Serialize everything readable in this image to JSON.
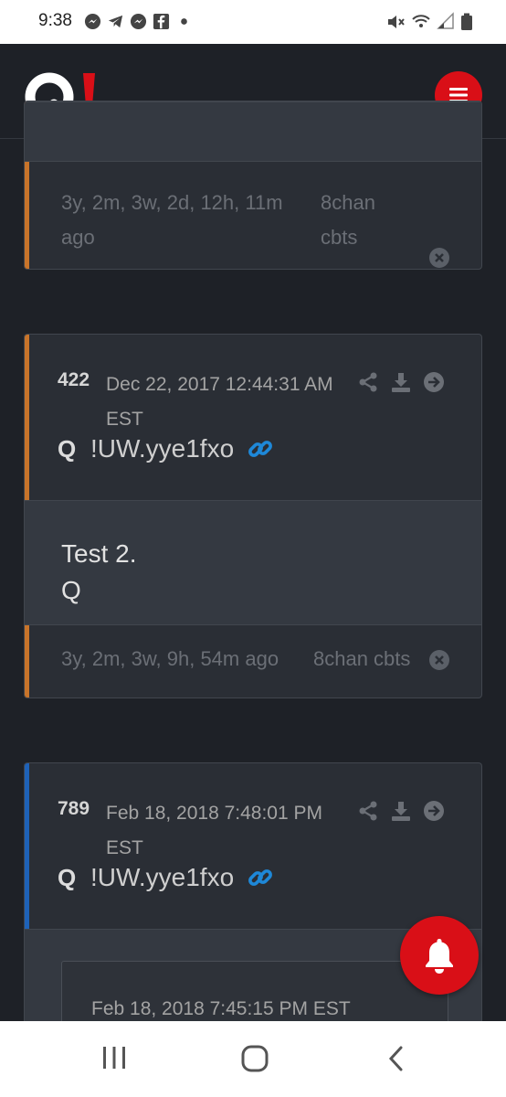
{
  "status_bar": {
    "time": "9:38",
    "notification_icons": [
      "messenger-icon",
      "telegram-icon",
      "messenger-icon",
      "facebook-icon",
      "dot-icon"
    ],
    "system_icons": [
      "mute-icon",
      "wifi-icon",
      "signal-icon",
      "battery-icon"
    ]
  },
  "header": {
    "logo_text": "Q!",
    "logo_colors": {
      "q": "#ffffff",
      "bang": "#d90f17"
    },
    "menu_icon": "hamburger-icon",
    "accent": "#d90f17"
  },
  "posts": [
    {
      "partial": true,
      "stripe_color": "#c8742a",
      "ago": "3y, 2m, 3w, 2d, 12h, 11m ago",
      "ago_line1": "3y, 2m, 3w, 2d, 12h, 11m",
      "ago_line2": "ago",
      "source_line1": "8chan",
      "source_line2": "cbts"
    },
    {
      "number": "422",
      "date_line1": "Dec 22, 2017 12:44:31 AM",
      "date_line2": "EST",
      "stripe_color": "#c8742a",
      "author": "Q",
      "tripcode": "!UW.yye1fxo",
      "body_lines": [
        "Test 2.",
        "Q"
      ],
      "ago": "3y, 2m, 3w, 9h, 54m ago",
      "source": "8chan cbts"
    },
    {
      "number": "789",
      "date_line1": "Feb 18, 2018 7:48:01 PM",
      "date_line2": "EST",
      "stripe_color": "#1e62b8",
      "author": "Q",
      "tripcode": "!UW.yye1fxo",
      "quoted_date": "Feb 18, 2018 7:45:15 PM EST"
    }
  ],
  "post_actions": [
    "share-icon",
    "download-icon",
    "arrow-right-circle-icon"
  ],
  "link_icon_color": "#1e88d8",
  "floating_button": {
    "icon": "bell-icon",
    "color": "#d90f17"
  },
  "nav_bar": [
    "recents-icon",
    "home-icon",
    "back-icon"
  ]
}
